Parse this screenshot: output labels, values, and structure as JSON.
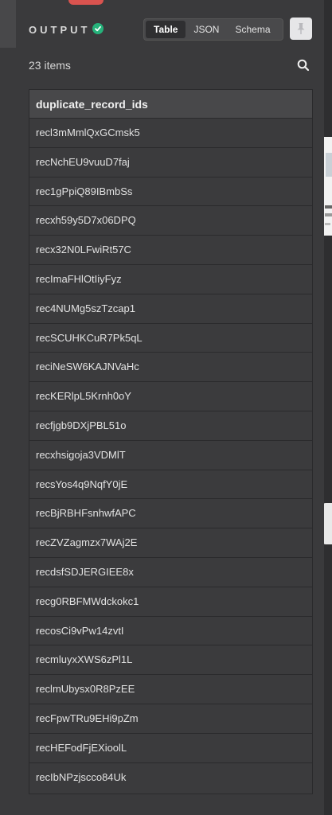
{
  "header": {
    "title": "OUTPUT",
    "status": "success",
    "tabs": [
      {
        "label": "Table",
        "active": true
      },
      {
        "label": "JSON",
        "active": false
      },
      {
        "label": "Schema",
        "active": false
      }
    ]
  },
  "results": {
    "count_label": "23 items",
    "column": "duplicate_record_ids",
    "rows": [
      "recl3mMmlQxGCmsk5",
      "recNchEU9vuuD7faj",
      "rec1gPpiQ89IBmbSs",
      "recxh59y5D7x06DPQ",
      "recx32N0LFwiRt57C",
      "recImaFHlOtIiyFyz",
      "rec4NUMg5szTzcap1",
      "recSCUHKCuR7Pk5qL",
      "reciNeSW6KAJNVaHc",
      "recKERlpL5Krnh0oY",
      "recfjgb9DXjPBL51o",
      "recxhsigoja3VDMlT",
      "recsYos4q9NqfY0jE",
      "recBjRBHFsnhwfAPC",
      "recZVZagmzx7WAj2E",
      "recdsfSDJERGIEE8x",
      "recg0RBFMWdckokc1",
      "recosCi9vPw14zvtI",
      "recmluyxXWS6zPl1L",
      "reclmUbysx0R8PzEE",
      "recFpwTRu9EHi9pZm",
      "recHEFodFjEXioolL",
      "recIbNPzjscco84Uk"
    ]
  },
  "colors": {
    "panel": "#3a3a3c",
    "success": "#26b27b",
    "accent": "#d9534f"
  },
  "icons": {
    "status": "check-circle-icon",
    "pin": "pin-icon",
    "search": "search-icon"
  }
}
